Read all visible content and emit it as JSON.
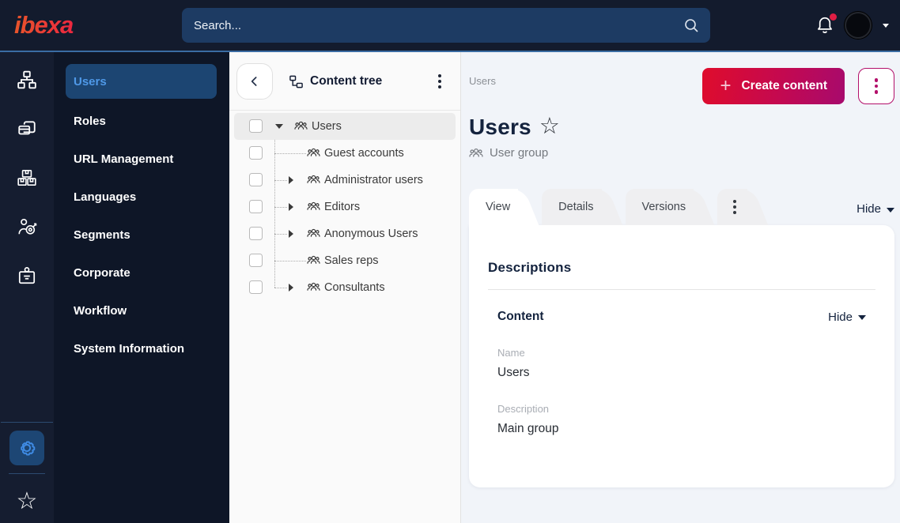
{
  "topbar": {
    "logo_text": "ibexa",
    "search": {
      "placeholder": "Search..."
    }
  },
  "icons": {
    "rail": [
      "content-structure",
      "pages",
      "product-catalog",
      "customer-segments",
      "admin-badge"
    ],
    "rail_footer": [
      "settings-gear",
      "bookmarks-star"
    ],
    "star": "☆",
    "kebab": "⋮"
  },
  "sidebar": {
    "items": [
      {
        "label": "Users",
        "active": true
      },
      {
        "label": "Roles"
      },
      {
        "label": "URL Management"
      },
      {
        "label": "Languages"
      },
      {
        "label": "Segments"
      },
      {
        "label": "Corporate"
      },
      {
        "label": "Workflow"
      },
      {
        "label": "System Information"
      }
    ]
  },
  "content_tree": {
    "title": "Content tree",
    "items": [
      {
        "label": "Users",
        "state": "expanded",
        "selected": true
      },
      {
        "label": "Guest accounts",
        "state": "leaf"
      },
      {
        "label": "Administrator users",
        "state": "collapsed"
      },
      {
        "label": "Editors",
        "state": "collapsed"
      },
      {
        "label": "Anonymous Users",
        "state": "collapsed"
      },
      {
        "label": "Sales reps",
        "state": "leaf"
      },
      {
        "label": "Consultants",
        "state": "collapsed"
      }
    ]
  },
  "main": {
    "breadcrumb": "Users",
    "create_content_label": "Create content",
    "title": "Users",
    "content_type_label": "User group",
    "tabs": [
      {
        "label": "View",
        "active": true
      },
      {
        "label": "Details"
      },
      {
        "label": "Versions"
      }
    ],
    "hide_label": "Hide",
    "panel": {
      "descriptions_heading": "Descriptions",
      "content_heading": "Content",
      "content_hide_label": "Hide",
      "fields": [
        {
          "label": "Name",
          "value": "Users"
        },
        {
          "label": "Description",
          "value": "Main group"
        }
      ]
    }
  },
  "colors": {
    "topbar_bg": "#131b2d",
    "topbar_border": "#3a6ca3",
    "sidebar_bg": "#0e1627",
    "active_item_bg": "#1c4572",
    "active_item_text": "#4f99e8",
    "accent_gradient_start": "#df0c2c",
    "accent_gradient_end": "#a70a6d",
    "notification_dot": "#e01e44"
  }
}
